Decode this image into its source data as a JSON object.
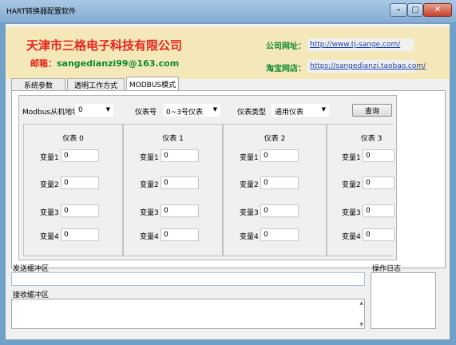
{
  "window": {
    "title": "HART转换器配置软件",
    "min_glyph": "–",
    "max_glyph": "□",
    "close_glyph": "✕"
  },
  "header": {
    "company": "天津市三格电子科技有限公司",
    "email_label": "邮箱：",
    "email": "sangedianzi99@163.com",
    "site_label": "公司网址：",
    "site_url": "http://www.tj-sange.com/",
    "shop_label": "淘宝网店：",
    "shop_url": "https://sangedianzi.taobao.com/"
  },
  "tabs": [
    {
      "label": "系统参数"
    },
    {
      "label": "透明工作方式"
    },
    {
      "label": "MODBUS模式"
    }
  ],
  "modbus": {
    "slave_addr_label": "Modbus从机地址",
    "slave_addr_value": "0",
    "meter_no_label": "仪表号",
    "meter_no_value": "0~3号仪表",
    "meter_type_label": "仪表类型",
    "meter_type_value": "通用仪表",
    "query_label": "查询",
    "arrow": "▼"
  },
  "meters": [
    {
      "title": "仪表 0",
      "vars": [
        {
          "label": "变量1",
          "value": "0"
        },
        {
          "label": "变量2",
          "value": "0"
        },
        {
          "label": "变量3",
          "value": "0"
        },
        {
          "label": "变量4",
          "value": "0"
        }
      ]
    },
    {
      "title": "仪表 1",
      "vars": [
        {
          "label": "变量1",
          "value": "0"
        },
        {
          "label": "变量2",
          "value": "0"
        },
        {
          "label": "变量3",
          "value": "0"
        },
        {
          "label": "变量4",
          "value": "0"
        }
      ]
    },
    {
      "title": "仪表 2",
      "vars": [
        {
          "label": "变量1",
          "value": "0"
        },
        {
          "label": "变量2",
          "value": "0"
        },
        {
          "label": "变量3",
          "value": "0"
        },
        {
          "label": "变量4",
          "value": "0"
        }
      ]
    },
    {
      "title": "仪表 3",
      "vars": [
        {
          "label": "变量1",
          "value": "0"
        },
        {
          "label": "变量2",
          "value": "0"
        },
        {
          "label": "变量3",
          "value": "0"
        },
        {
          "label": "变量4",
          "value": "0"
        }
      ]
    }
  ],
  "bottom": {
    "send_label": "发送缓冲区",
    "send_value": "",
    "recv_label": "接收缓冲区",
    "recv_value": "",
    "log_label": "操作日志"
  }
}
